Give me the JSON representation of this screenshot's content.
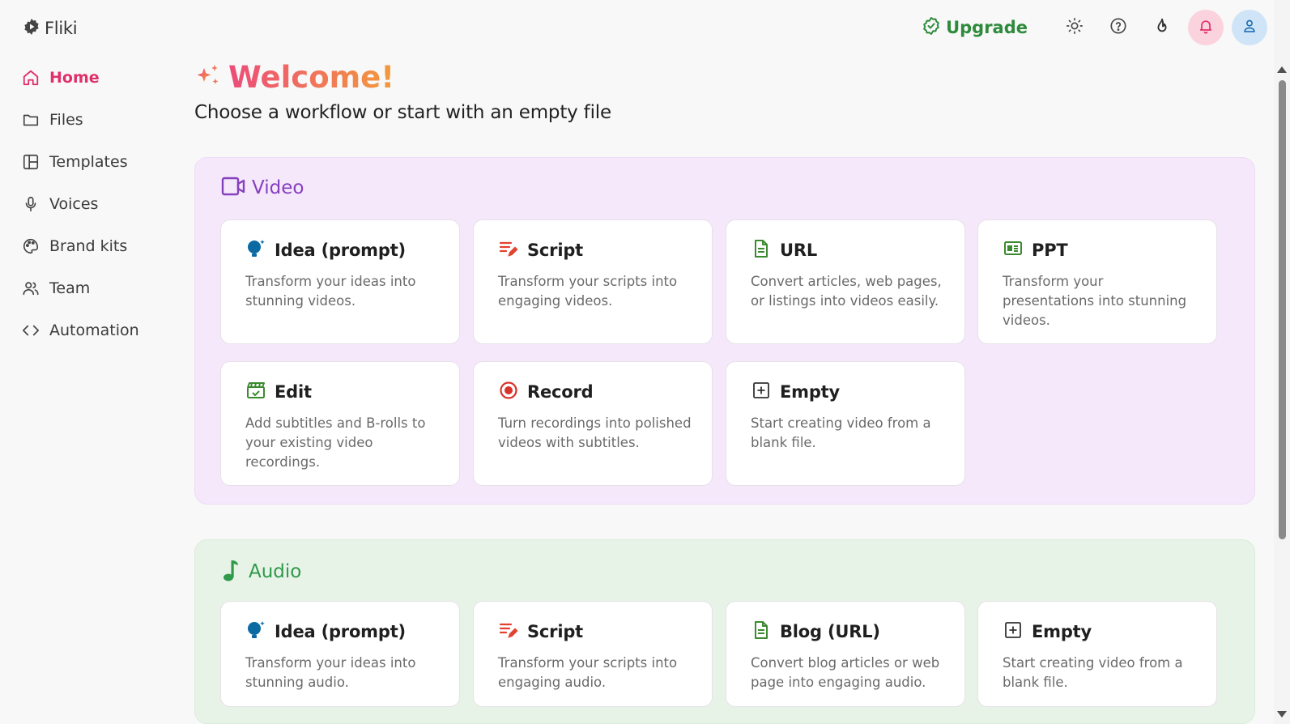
{
  "app": {
    "name": "Fliki"
  },
  "sidebar": {
    "items": [
      {
        "label": "Home",
        "icon": "home-icon"
      },
      {
        "label": "Files",
        "icon": "folder-icon"
      },
      {
        "label": "Templates",
        "icon": "layout-icon"
      },
      {
        "label": "Voices",
        "icon": "mic-icon"
      },
      {
        "label": "Brand kits",
        "icon": "palette-icon"
      },
      {
        "label": "Team",
        "icon": "users-icon"
      },
      {
        "label": "Automation",
        "icon": "code-icon"
      }
    ],
    "active": "Home"
  },
  "topbar": {
    "upgrade_label": "Upgrade",
    "icons": [
      "sun-icon",
      "help-icon",
      "flame-icon",
      "bell-icon",
      "user-icon"
    ]
  },
  "main": {
    "welcome": "Welcome!",
    "subtitle": "Choose a workflow or start with an empty file"
  },
  "video": {
    "title": "Video",
    "cards": [
      {
        "title": "Idea (prompt)",
        "desc": "Transform your ideas into stunning videos.",
        "icon": "idea-icon"
      },
      {
        "title": "Script",
        "desc": "Transform your scripts into engaging videos.",
        "icon": "script-icon"
      },
      {
        "title": "URL",
        "desc": "Convert articles, web pages, or listings into videos easily.",
        "icon": "document-icon"
      },
      {
        "title": "PPT",
        "desc": "Transform your presentations into stunning videos.",
        "icon": "presentation-icon"
      },
      {
        "title": "Edit",
        "desc": "Add subtitles and B-rolls to your existing video recordings.",
        "icon": "clapper-icon"
      },
      {
        "title": "Record",
        "desc": "Turn recordings into polished videos with subtitles.",
        "icon": "record-icon"
      },
      {
        "title": "Empty",
        "desc": "Start creating video from a blank file.",
        "icon": "plus-square-icon"
      }
    ]
  },
  "audio": {
    "title": "Audio",
    "cards": [
      {
        "title": "Idea (prompt)",
        "desc": "Transform your ideas into stunning audio.",
        "icon": "idea-icon"
      },
      {
        "title": "Script",
        "desc": "Transform your scripts into engaging audio.",
        "icon": "script-icon"
      },
      {
        "title": "Blog (URL)",
        "desc": "Convert blog articles or web page into engaging audio.",
        "icon": "document-icon"
      },
      {
        "title": "Empty",
        "desc": "Start creating video from a blank file.",
        "icon": "plus-square-icon"
      }
    ]
  },
  "colors": {
    "accent_pink": "#e0306a",
    "upgrade_green": "#2f8b3c",
    "video_purple": "#8540bf",
    "audio_green": "#2e9a4a"
  }
}
